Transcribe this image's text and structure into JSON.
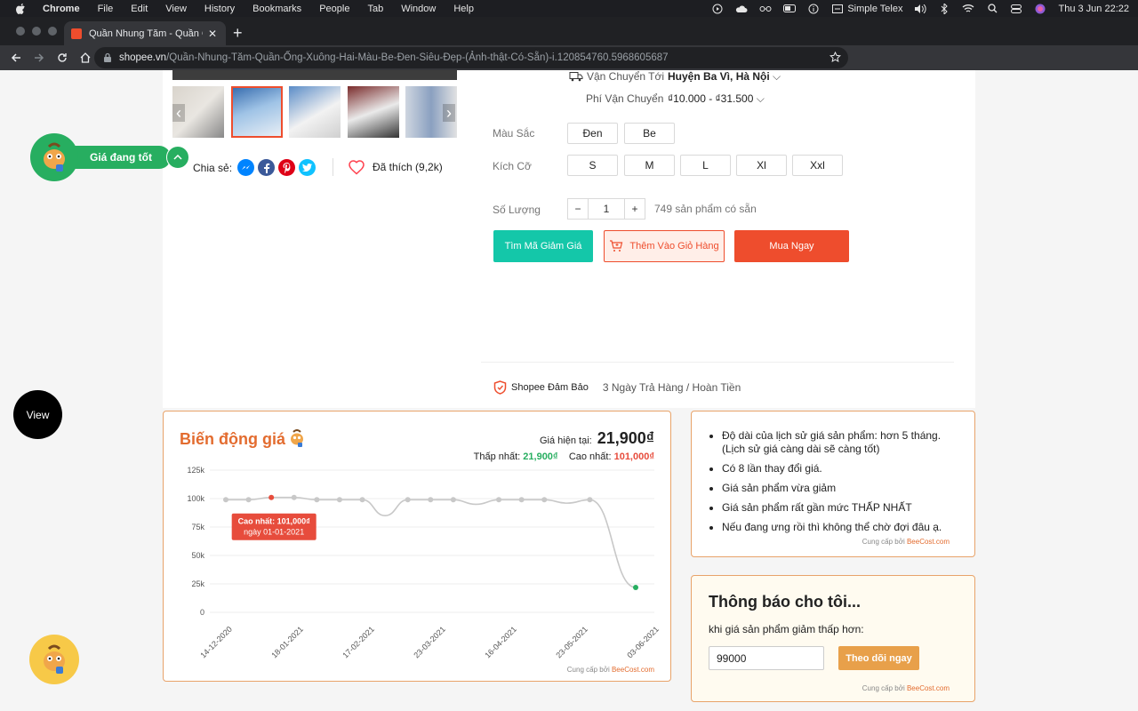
{
  "menubar": {
    "app": "Chrome",
    "items": [
      "File",
      "Edit",
      "View",
      "History",
      "Bookmarks",
      "People",
      "Tab",
      "Window",
      "Help"
    ],
    "status_text": "Simple Telex",
    "datetime": "Thu 3 Jun  22:22"
  },
  "browser": {
    "tab_title": "Quần Nhung Tăm - Quần Ống X",
    "url_host": "shopee.vn",
    "url_path": "/Quần-Nhung-Tăm-Quần-Ống-Xuông-Hai-Màu-Be-Đen-Siêu-Đẹp-(Ảnh-thật-Có-Sẵn)-i.120854760.5968605687"
  },
  "product": {
    "shipping": {
      "to_label": "Vận Chuyển Tới",
      "to_value": "Huyện Ba Vì, Hà Nội",
      "fee_label": "Phí Vận Chuyển",
      "fee_value": "₫10.000 - ₫31.500"
    },
    "color_label": "Màu Sắc",
    "colors": [
      "Đen",
      "Be"
    ],
    "size_label": "Kích Cỡ",
    "sizes": [
      "S",
      "M",
      "L",
      "Xl",
      "Xxl"
    ],
    "quantity_label": "Số Lượng",
    "quantity": "1",
    "stock": "749 sản phẩm có sẵn",
    "buttons": {
      "voucher": "Tìm Mã Giảm Giá",
      "cart": "Thêm Vào Giỏ Hàng",
      "buy": "Mua Ngay"
    },
    "share_label": "Chia sẻ:",
    "like_label": "Đã thích (9,2k)",
    "guarantee_label": "Shopee Đảm Bảo",
    "guarantee_text": "3 Ngày Trả Hàng / Hoàn Tiền"
  },
  "widgets": {
    "status_pill": "Giá đang tốt",
    "view_button": "View"
  },
  "price_card": {
    "title": "Biến động giá",
    "current_label": "Giá hiện tại:",
    "current_value": "21,900₫",
    "min_label": "Thấp nhất:",
    "min_value": "21,900₫",
    "max_label": "Cao nhất:",
    "max_value": "101,000₫",
    "tooltip_line1": "Cao nhất: 101,000₫",
    "tooltip_line2": "ngày 01-01-2021",
    "credit_prefix": "Cung cấp bởi",
    "credit_brand": "BeeCost.com"
  },
  "chart_data": {
    "type": "line",
    "y_ticks": [
      "0",
      "25k",
      "50k",
      "75k",
      "100k",
      "125k"
    ],
    "ylim": [
      0,
      125000
    ],
    "x_ticks": [
      "14-12-2020",
      "18-01-2021",
      "17-02-2021",
      "23-03-2021",
      "16-04-2021",
      "23-05-2021",
      "03-06-2021"
    ],
    "values": [
      99000,
      99000,
      101000,
      101000,
      99000,
      99000,
      99000,
      85000,
      99000,
      99000,
      99000,
      95000,
      99000,
      99000,
      99000,
      96000,
      99000,
      21900
    ],
    "grid": true,
    "colors": {
      "line": "#c8c8c8",
      "point": "#c8c8c8",
      "max_point": "#e74c3c",
      "min_point": "#27ae60",
      "tooltip": "#e74c3c"
    }
  },
  "info_card": {
    "items": [
      "Độ dài của lịch sử giá sản phẩm: hơn 5 tháng. (Lịch sử giá càng dài sẽ càng tốt)",
      "Có 8 lần thay đổi giá.",
      "Giá sản phẩm vừa giảm",
      "Giá sản phẩm rất gần mức THẤP NHẤT",
      "Nếu đang ưng rồi thì không thể chờ đợi đâu ạ."
    ],
    "credit_prefix": "Cung cấp bởi",
    "credit_brand": "BeeCost.com"
  },
  "notify_card": {
    "title": "Thông báo cho tôi...",
    "subtitle": "khi giá sản phẩm giảm thấp hơn:",
    "input_value": "99000",
    "button": "Theo dõi ngay",
    "credit_prefix": "Cung cấp bởi",
    "credit_brand": "BeeCost.com"
  }
}
